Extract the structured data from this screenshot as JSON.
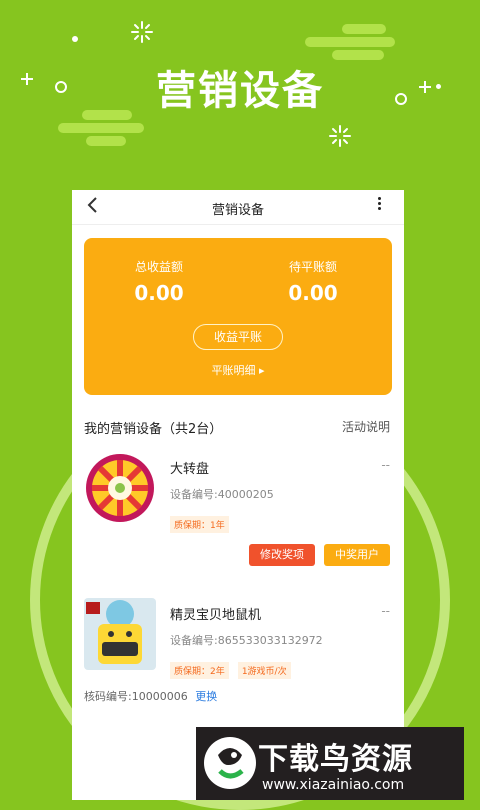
{
  "promo": {
    "title": "营销设备"
  },
  "nav": {
    "back_icon": "chevron-left-icon",
    "title": "营销设备",
    "more_icon": "more-vertical-icon"
  },
  "earnings": {
    "total_label": "总收益额",
    "total_value": "0.00",
    "pending_label": "待平账额",
    "pending_value": "0.00",
    "settle_button": "收益平账",
    "detail_link": "平账明细 ▸"
  },
  "devices_section": {
    "title": "我的营销设备（共2台）",
    "activity_link": "活动说明"
  },
  "devices": [
    {
      "name": "大转盘",
      "status": "--",
      "code": "设备编号:40000205",
      "tags": [
        "质保期：1年"
      ],
      "buttons": [
        "修改奖项",
        "中奖用户"
      ]
    },
    {
      "name": "精灵宝贝地鼠机",
      "status": "--",
      "code": "设备编号:865533033132972",
      "tags": [
        "质保期：2年",
        "1游戏币/次"
      ]
    }
  ],
  "bottom": {
    "code_text": "核码编号:10000006",
    "change_link": "更换"
  },
  "watermark": {
    "name": "下载鸟资源",
    "url": "www.xiazainiao.com"
  },
  "colors": {
    "background": "#86c51f",
    "accent_orange": "#fbac11",
    "button_red": "#f0522c"
  }
}
